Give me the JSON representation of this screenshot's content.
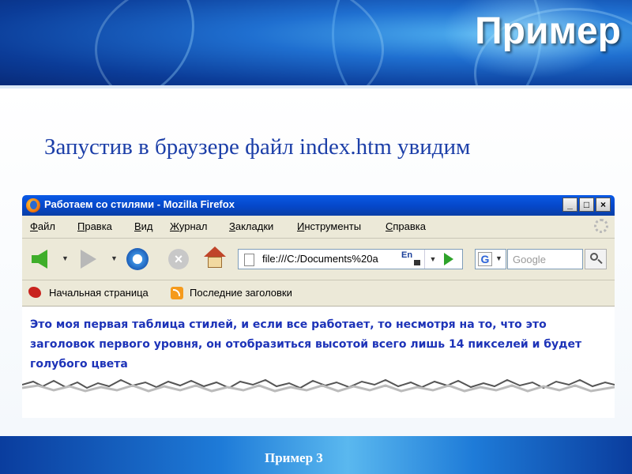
{
  "slide": {
    "title": "Пример",
    "lead": "Запустив в браузере файл index.htm увидим",
    "footer": "Пример 3"
  },
  "browser": {
    "window_title": "Работаем со стилями - Mozilla Firefox",
    "menu": [
      {
        "first": "Ф",
        "rest": "айл"
      },
      {
        "first": "П",
        "rest": "равка"
      },
      {
        "first": "В",
        "rest": "ид"
      },
      {
        "first": "Ж",
        "rest": "урнал"
      },
      {
        "first": "З",
        "rest": "акладки"
      },
      {
        "first": "И",
        "rest": "нструменты"
      },
      {
        "first": "С",
        "rest": "правка"
      }
    ],
    "address": "file:///C:/Documents%20a",
    "language_badge": "En",
    "search_engine": "G",
    "search_placeholder": "Google",
    "bookmarks": [
      "Начальная страница",
      "Последние заголовки"
    ],
    "content_text": "Это моя первая таблица стилей, и если все работает, то несмотря на то, что это заголовок первого уровня, он отобразиться высотой всего лишь 14 пикселей и будет голубого цвета"
  },
  "colors": {
    "accent_blue": "#1c3fa8",
    "content_text": "#1d33b8",
    "titlebar": "#0547c8"
  },
  "icons": [
    "firefox-logo-icon",
    "back-arrow-icon",
    "forward-arrow-icon",
    "reload-icon",
    "stop-icon",
    "home-icon",
    "page-icon",
    "lock-icon",
    "go-arrow-icon",
    "google-g-icon",
    "search-icon",
    "home-bookmark-icon",
    "rss-icon"
  ]
}
